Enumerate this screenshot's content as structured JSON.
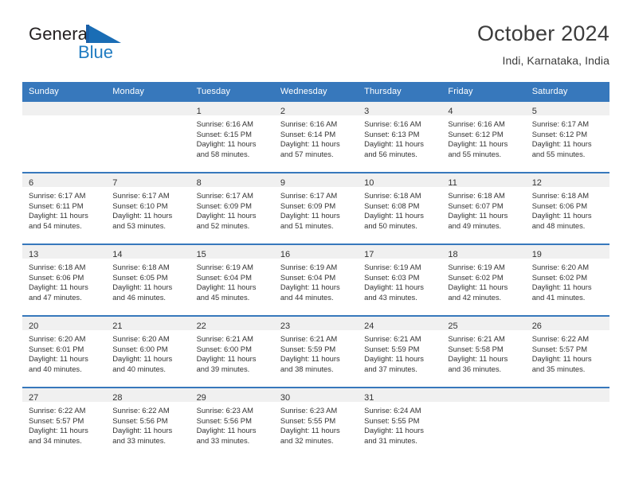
{
  "brand": {
    "name_part1": "General",
    "name_part2": "Blue",
    "logo_icon": "triangle-flag-icon"
  },
  "header": {
    "title": "October 2024",
    "subtitle": "Indi, Karnataka, India"
  },
  "colors": {
    "header_blue": "#3778bc",
    "brand_blue": "#1f7bc1",
    "day_band_grey": "#f0f0f0",
    "text": "#333333"
  },
  "weekday_headers": [
    "Sunday",
    "Monday",
    "Tuesday",
    "Wednesday",
    "Thursday",
    "Friday",
    "Saturday"
  ],
  "weeks": [
    [
      {
        "day": "",
        "lines": []
      },
      {
        "day": "",
        "lines": []
      },
      {
        "day": "1",
        "lines": [
          "Sunrise: 6:16 AM",
          "Sunset: 6:15 PM",
          "Daylight: 11 hours",
          "and 58 minutes."
        ]
      },
      {
        "day": "2",
        "lines": [
          "Sunrise: 6:16 AM",
          "Sunset: 6:14 PM",
          "Daylight: 11 hours",
          "and 57 minutes."
        ]
      },
      {
        "day": "3",
        "lines": [
          "Sunrise: 6:16 AM",
          "Sunset: 6:13 PM",
          "Daylight: 11 hours",
          "and 56 minutes."
        ]
      },
      {
        "day": "4",
        "lines": [
          "Sunrise: 6:16 AM",
          "Sunset: 6:12 PM",
          "Daylight: 11 hours",
          "and 55 minutes."
        ]
      },
      {
        "day": "5",
        "lines": [
          "Sunrise: 6:17 AM",
          "Sunset: 6:12 PM",
          "Daylight: 11 hours",
          "and 55 minutes."
        ]
      }
    ],
    [
      {
        "day": "6",
        "lines": [
          "Sunrise: 6:17 AM",
          "Sunset: 6:11 PM",
          "Daylight: 11 hours",
          "and 54 minutes."
        ]
      },
      {
        "day": "7",
        "lines": [
          "Sunrise: 6:17 AM",
          "Sunset: 6:10 PM",
          "Daylight: 11 hours",
          "and 53 minutes."
        ]
      },
      {
        "day": "8",
        "lines": [
          "Sunrise: 6:17 AM",
          "Sunset: 6:09 PM",
          "Daylight: 11 hours",
          "and 52 minutes."
        ]
      },
      {
        "day": "9",
        "lines": [
          "Sunrise: 6:17 AM",
          "Sunset: 6:09 PM",
          "Daylight: 11 hours",
          "and 51 minutes."
        ]
      },
      {
        "day": "10",
        "lines": [
          "Sunrise: 6:18 AM",
          "Sunset: 6:08 PM",
          "Daylight: 11 hours",
          "and 50 minutes."
        ]
      },
      {
        "day": "11",
        "lines": [
          "Sunrise: 6:18 AM",
          "Sunset: 6:07 PM",
          "Daylight: 11 hours",
          "and 49 minutes."
        ]
      },
      {
        "day": "12",
        "lines": [
          "Sunrise: 6:18 AM",
          "Sunset: 6:06 PM",
          "Daylight: 11 hours",
          "and 48 minutes."
        ]
      }
    ],
    [
      {
        "day": "13",
        "lines": [
          "Sunrise: 6:18 AM",
          "Sunset: 6:06 PM",
          "Daylight: 11 hours",
          "and 47 minutes."
        ]
      },
      {
        "day": "14",
        "lines": [
          "Sunrise: 6:18 AM",
          "Sunset: 6:05 PM",
          "Daylight: 11 hours",
          "and 46 minutes."
        ]
      },
      {
        "day": "15",
        "lines": [
          "Sunrise: 6:19 AM",
          "Sunset: 6:04 PM",
          "Daylight: 11 hours",
          "and 45 minutes."
        ]
      },
      {
        "day": "16",
        "lines": [
          "Sunrise: 6:19 AM",
          "Sunset: 6:04 PM",
          "Daylight: 11 hours",
          "and 44 minutes."
        ]
      },
      {
        "day": "17",
        "lines": [
          "Sunrise: 6:19 AM",
          "Sunset: 6:03 PM",
          "Daylight: 11 hours",
          "and 43 minutes."
        ]
      },
      {
        "day": "18",
        "lines": [
          "Sunrise: 6:19 AM",
          "Sunset: 6:02 PM",
          "Daylight: 11 hours",
          "and 42 minutes."
        ]
      },
      {
        "day": "19",
        "lines": [
          "Sunrise: 6:20 AM",
          "Sunset: 6:02 PM",
          "Daylight: 11 hours",
          "and 41 minutes."
        ]
      }
    ],
    [
      {
        "day": "20",
        "lines": [
          "Sunrise: 6:20 AM",
          "Sunset: 6:01 PM",
          "Daylight: 11 hours",
          "and 40 minutes."
        ]
      },
      {
        "day": "21",
        "lines": [
          "Sunrise: 6:20 AM",
          "Sunset: 6:00 PM",
          "Daylight: 11 hours",
          "and 40 minutes."
        ]
      },
      {
        "day": "22",
        "lines": [
          "Sunrise: 6:21 AM",
          "Sunset: 6:00 PM",
          "Daylight: 11 hours",
          "and 39 minutes."
        ]
      },
      {
        "day": "23",
        "lines": [
          "Sunrise: 6:21 AM",
          "Sunset: 5:59 PM",
          "Daylight: 11 hours",
          "and 38 minutes."
        ]
      },
      {
        "day": "24",
        "lines": [
          "Sunrise: 6:21 AM",
          "Sunset: 5:59 PM",
          "Daylight: 11 hours",
          "and 37 minutes."
        ]
      },
      {
        "day": "25",
        "lines": [
          "Sunrise: 6:21 AM",
          "Sunset: 5:58 PM",
          "Daylight: 11 hours",
          "and 36 minutes."
        ]
      },
      {
        "day": "26",
        "lines": [
          "Sunrise: 6:22 AM",
          "Sunset: 5:57 PM",
          "Daylight: 11 hours",
          "and 35 minutes."
        ]
      }
    ],
    [
      {
        "day": "27",
        "lines": [
          "Sunrise: 6:22 AM",
          "Sunset: 5:57 PM",
          "Daylight: 11 hours",
          "and 34 minutes."
        ]
      },
      {
        "day": "28",
        "lines": [
          "Sunrise: 6:22 AM",
          "Sunset: 5:56 PM",
          "Daylight: 11 hours",
          "and 33 minutes."
        ]
      },
      {
        "day": "29",
        "lines": [
          "Sunrise: 6:23 AM",
          "Sunset: 5:56 PM",
          "Daylight: 11 hours",
          "and 33 minutes."
        ]
      },
      {
        "day": "30",
        "lines": [
          "Sunrise: 6:23 AM",
          "Sunset: 5:55 PM",
          "Daylight: 11 hours",
          "and 32 minutes."
        ]
      },
      {
        "day": "31",
        "lines": [
          "Sunrise: 6:24 AM",
          "Sunset: 5:55 PM",
          "Daylight: 11 hours",
          "and 31 minutes."
        ]
      },
      {
        "day": "",
        "lines": []
      },
      {
        "day": "",
        "lines": []
      }
    ]
  ]
}
